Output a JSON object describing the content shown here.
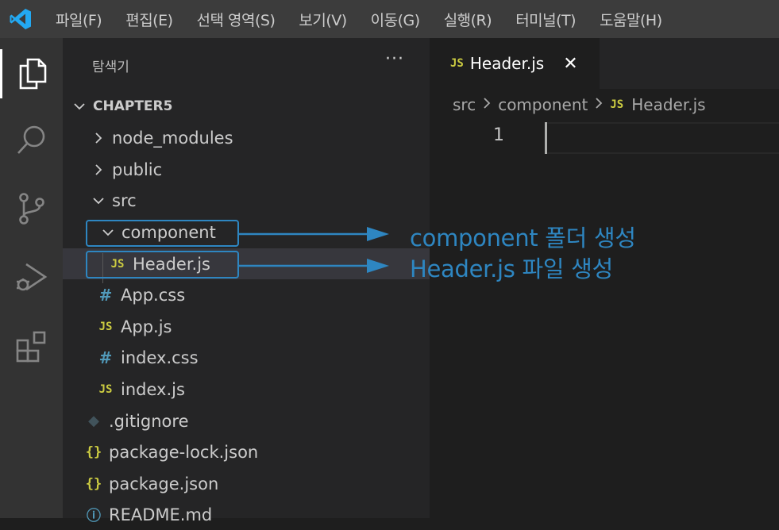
{
  "menubar": {
    "items": [
      "파일(F)",
      "편집(E)",
      "선택 영역(S)",
      "보기(V)",
      "이동(G)",
      "실행(R)",
      "터미널(T)",
      "도움말(H)"
    ]
  },
  "activity_bar": {
    "icons": [
      "explorer-icon",
      "search-icon",
      "source-control-icon",
      "run-debug-icon",
      "extensions-icon"
    ]
  },
  "sidebar": {
    "title": "탐색기",
    "more": "···",
    "root": "CHAPTER5",
    "items": [
      {
        "label": "node_modules",
        "type": "folder-collapsed"
      },
      {
        "label": "public",
        "type": "folder-collapsed"
      },
      {
        "label": "src",
        "type": "folder-expanded"
      },
      {
        "label": "component",
        "type": "folder-expanded"
      },
      {
        "label": "Header.js",
        "type": "js",
        "icon_text": "JS"
      },
      {
        "label": "App.css",
        "type": "css",
        "icon_text": "#"
      },
      {
        "label": "App.js",
        "type": "js",
        "icon_text": "JS"
      },
      {
        "label": "index.css",
        "type": "css",
        "icon_text": "#"
      },
      {
        "label": "index.js",
        "type": "js",
        "icon_text": "JS"
      },
      {
        "label": ".gitignore",
        "type": "git",
        "icon_text": "◆"
      },
      {
        "label": "package-lock.json",
        "type": "json",
        "icon_text": "{}"
      },
      {
        "label": "package.json",
        "type": "json",
        "icon_text": "{}"
      },
      {
        "label": "README.md",
        "type": "info",
        "icon_text": "ⓘ"
      }
    ]
  },
  "editor": {
    "tab": {
      "icon_text": "JS",
      "label": "Header.js",
      "close": "✕"
    },
    "breadcrumb": {
      "parts": [
        "src",
        "component"
      ],
      "file_icon": "JS",
      "file": "Header.js"
    },
    "line_number": "1"
  },
  "annotations": {
    "component_note": "component 폴더 생성",
    "header_note": "Header.js 파일 생성"
  },
  "colors": {
    "accent": "#2e86c1",
    "js_icon": "#cbcb41",
    "css_icon": "#519aba",
    "menubar_bg": "#3c3c3c",
    "sidebar_bg": "#252526",
    "editor_bg": "#1e1e1e"
  }
}
